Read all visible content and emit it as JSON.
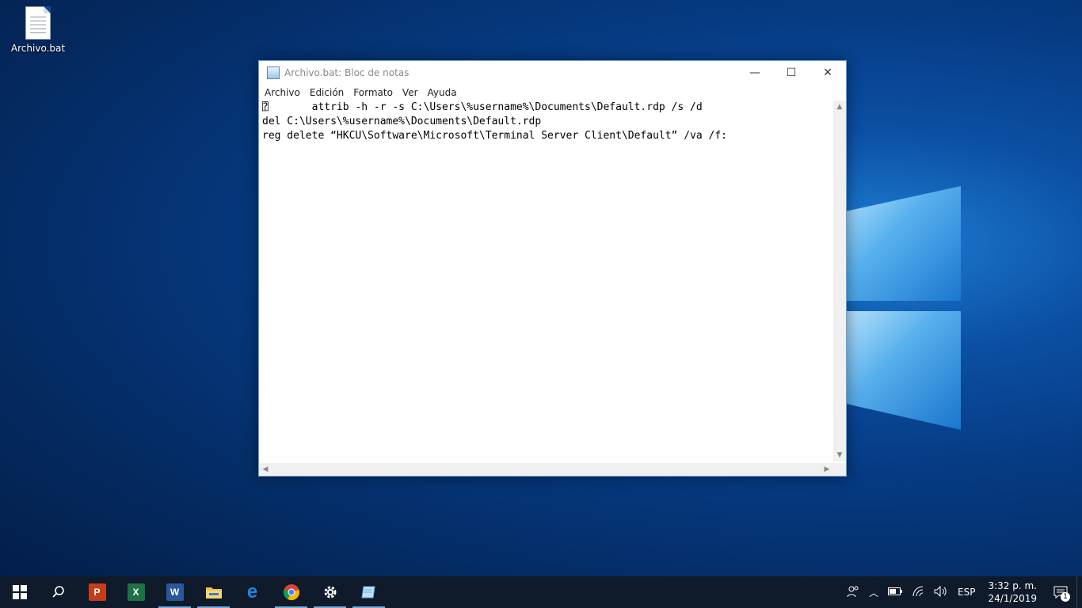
{
  "desktop": {
    "icons": [
      {
        "label": "Archivo.bat",
        "icon": "batch-file-icon"
      }
    ]
  },
  "notepad": {
    "title": "Archivo.bat: Bloc de notas",
    "menu": [
      "Archivo",
      "Edición",
      "Formato",
      "Ver",
      "Ayuda"
    ],
    "content": "⍰       attrib -h -r -s C:\\Users\\%username%\\Documents\\Default.rdp /s /d\ndel C:\\Users\\%username%\\Documents\\Default.rdp\nreg delete “HKCU\\Software\\Microsoft\\Terminal Server Client\\Default” /va /f:",
    "controls": {
      "minimize": "—",
      "maximize": "☐",
      "close": "✕"
    }
  },
  "taskbar": {
    "apps": [
      {
        "name": "start",
        "icon": "windows-start-icon"
      },
      {
        "name": "search",
        "icon": "search-icon"
      },
      {
        "name": "powerpoint",
        "icon": "powerpoint-icon",
        "letter": "P",
        "color": "#c43e1c"
      },
      {
        "name": "excel",
        "icon": "excel-icon",
        "letter": "X",
        "color": "#1e7145"
      },
      {
        "name": "word",
        "icon": "word-icon",
        "letter": "W",
        "color": "#2b579a"
      },
      {
        "name": "file-explorer",
        "icon": "folder-icon",
        "color": "#f2c14e"
      },
      {
        "name": "edge",
        "icon": "edge-icon",
        "letter": "e",
        "color": "#1e88e5"
      },
      {
        "name": "chrome",
        "icon": "chrome-icon"
      },
      {
        "name": "settings",
        "icon": "gear-icon"
      },
      {
        "name": "notepad",
        "icon": "notepad-icon"
      }
    ],
    "tray": {
      "language": "ESP",
      "time": "3:32 p. m.",
      "date": "24/1/2019",
      "notifications": "1"
    }
  }
}
